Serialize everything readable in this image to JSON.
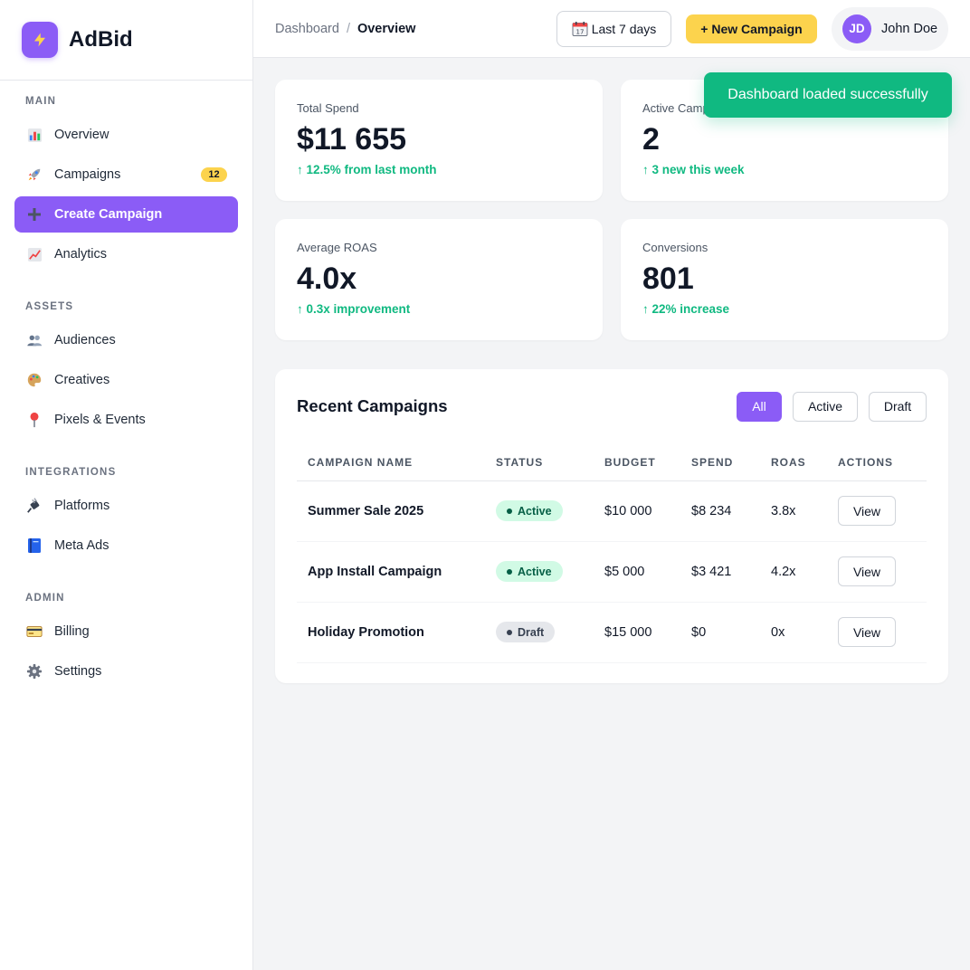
{
  "brand": {
    "name": "AdBid",
    "logo_icon": "lightning-icon"
  },
  "sidebar": {
    "sections": [
      {
        "title": "MAIN",
        "items": [
          {
            "label": "Overview",
            "icon": "bar-chart-icon"
          },
          {
            "label": "Campaigns",
            "icon": "rocket-icon",
            "badge": "12"
          },
          {
            "label": "Create Campaign",
            "icon": "plus-icon",
            "active": true
          },
          {
            "label": "Analytics",
            "icon": "trending-up-icon"
          }
        ]
      },
      {
        "title": "ASSETS",
        "items": [
          {
            "label": "Audiences",
            "icon": "people-icon"
          },
          {
            "label": "Creatives",
            "icon": "palette-icon"
          },
          {
            "label": "Pixels & Events",
            "icon": "pin-icon"
          }
        ]
      },
      {
        "title": "INTEGRATIONS",
        "items": [
          {
            "label": "Platforms",
            "icon": "plug-icon"
          },
          {
            "label": "Meta Ads",
            "icon": "book-icon"
          }
        ]
      },
      {
        "title": "ADMIN",
        "items": [
          {
            "label": "Billing",
            "icon": "credit-card-icon"
          },
          {
            "label": "Settings",
            "icon": "gear-icon"
          }
        ]
      }
    ]
  },
  "topbar": {
    "breadcrumb": {
      "parent": "Dashboard",
      "separator": "/",
      "current": "Overview"
    },
    "date_range": "Last 7 days",
    "new_campaign": "+ New Campaign",
    "user": {
      "initials": "JD",
      "name": "John Doe"
    }
  },
  "stats": [
    {
      "label": "Total Spend",
      "value": "$11 655",
      "change": "↑ 12.5% from last month"
    },
    {
      "label": "Active Campaigns",
      "value": "2",
      "change": "↑ 3 new this week"
    },
    {
      "label": "Average ROAS",
      "value": "4.0x",
      "change": "↑ 0.3x improvement"
    },
    {
      "label": "Conversions",
      "value": "801",
      "change": "↑ 22% increase"
    }
  ],
  "campaigns": {
    "title": "Recent Campaigns",
    "filters": [
      {
        "label": "All",
        "active": true
      },
      {
        "label": "Active"
      },
      {
        "label": "Draft"
      }
    ],
    "columns": [
      "CAMPAIGN NAME",
      "STATUS",
      "BUDGET",
      "SPEND",
      "ROAS",
      "ACTIONS"
    ],
    "rows": [
      {
        "name": "Summer Sale 2025",
        "status": "Active",
        "budget": "$10 000",
        "spend": "$8 234",
        "roas": "3.8x",
        "action": "View"
      },
      {
        "name": "App Install Campaign",
        "status": "Active",
        "budget": "$5 000",
        "spend": "$3 421",
        "roas": "4.2x",
        "action": "View"
      },
      {
        "name": "Holiday Promotion",
        "status": "Draft",
        "budget": "$15 000",
        "spend": "$0",
        "roas": "0x",
        "action": "View"
      }
    ]
  },
  "toast": {
    "message": "Dashboard loaded successfully"
  },
  "colors": {
    "accent": "#8b5cf6",
    "highlight": "#fcd34d",
    "success": "#10b981"
  }
}
